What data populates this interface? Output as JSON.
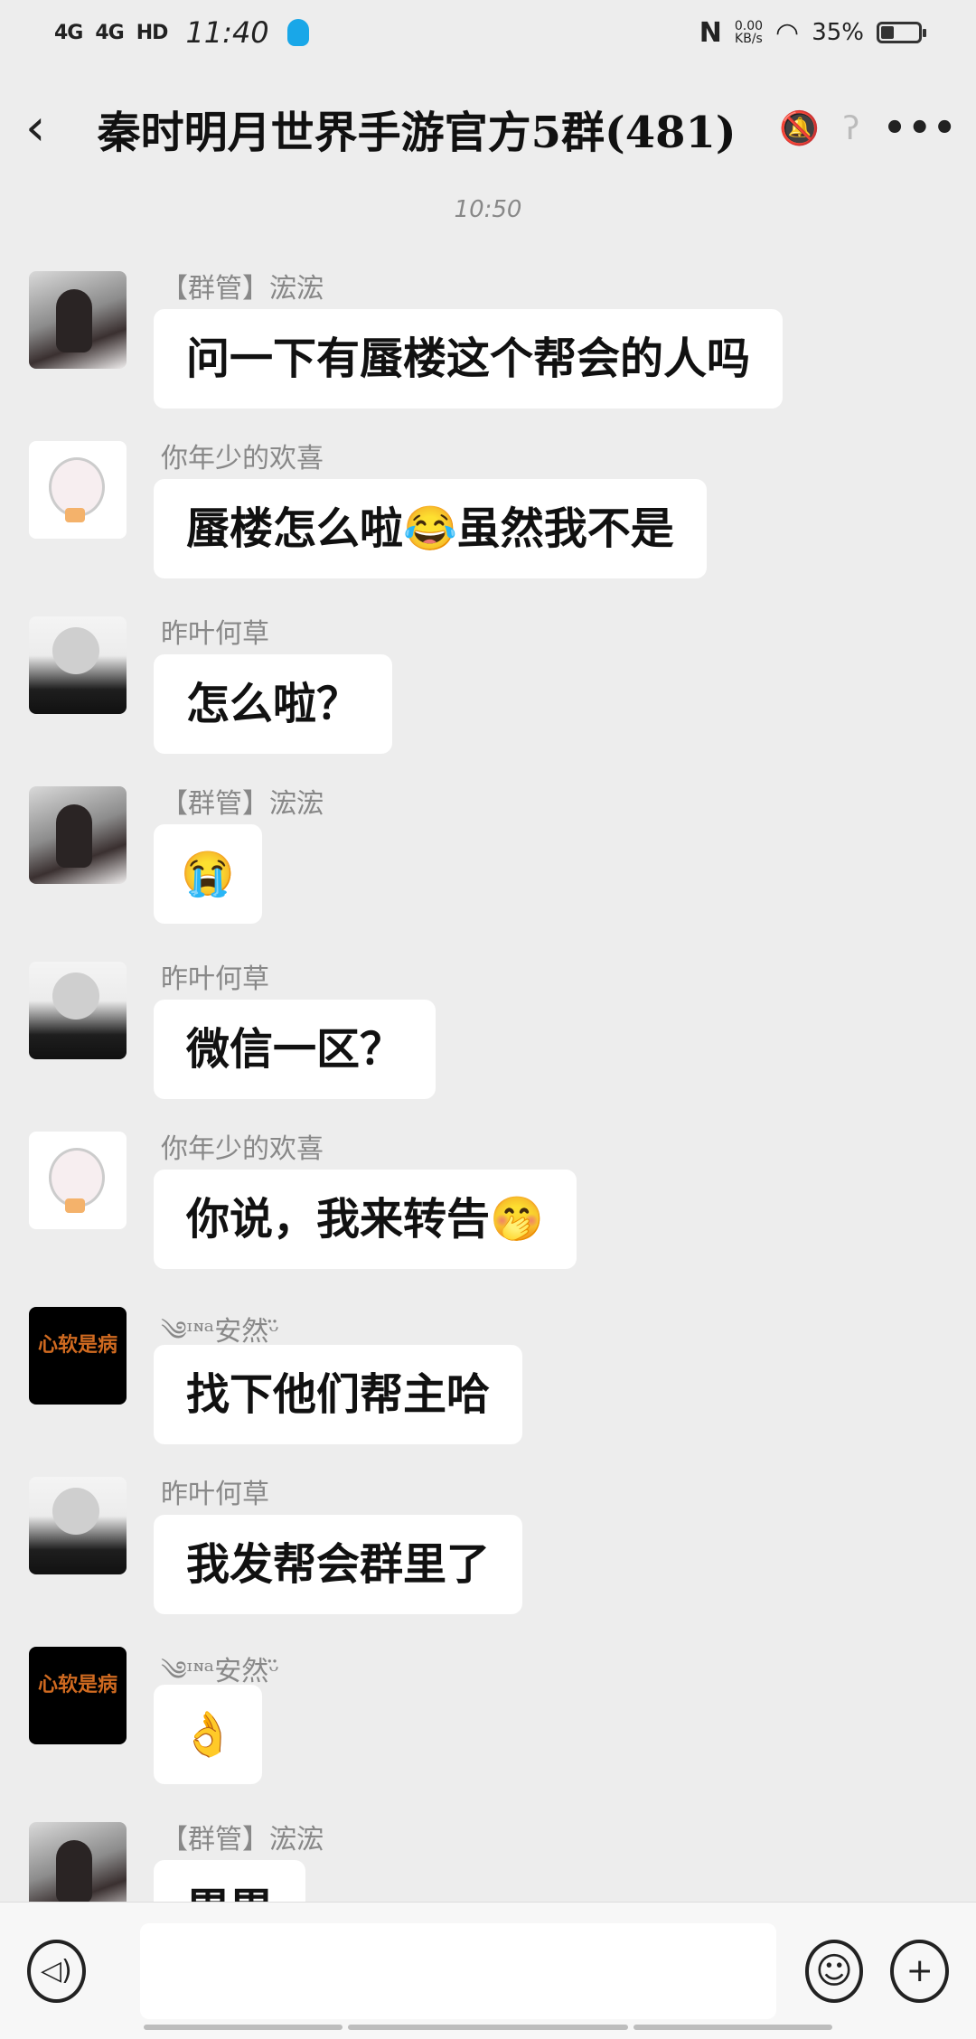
{
  "status": {
    "signal1": "4G",
    "signal2": "4G",
    "hd": "HD",
    "time": "11:40",
    "speed_value": "0.00",
    "speed_unit": "KB/s",
    "battery": "35%",
    "battery_level": 0.35
  },
  "header": {
    "back_icon": "back-arrow-icon",
    "title": "秦时明月世界手游官方5群(481)",
    "mute_icon": "bell-muted-icon",
    "ear_icon": "ear-icon",
    "more_icon": "more-dots-icon"
  },
  "timestamp": "10:50",
  "messages": [
    {
      "sender": "【群管】浤浤",
      "text": "问一下有蜃楼这个帮会的人吗"
    },
    {
      "sender": "你年少的欢喜",
      "text": "蜃楼怎么啦😂虽然我不是"
    },
    {
      "sender": "昨叶何草",
      "text": "怎么啦？"
    },
    {
      "sender": "【群管】浤浤",
      "text": "😭"
    },
    {
      "sender": "昨叶何草",
      "text": "微信一区？"
    },
    {
      "sender": "你年少的欢喜",
      "text": "你说，我来转告🤭"
    },
    {
      "sender": "༄ᶦᶰᵃ安然ᵕ̈",
      "text": "找下他们帮主哈"
    },
    {
      "sender": "昨叶何草",
      "text": "我发帮会群里了"
    },
    {
      "sender": "༄ᶦᶰᵃ安然ᵕ̈",
      "text": "👌"
    },
    {
      "sender": "【群管】浤浤",
      "text": "累累"
    }
  ],
  "input": {
    "placeholder": "",
    "voice_icon": "voice-icon",
    "emoji_icon": "emoji-icon",
    "plus_icon": "plus-icon"
  }
}
